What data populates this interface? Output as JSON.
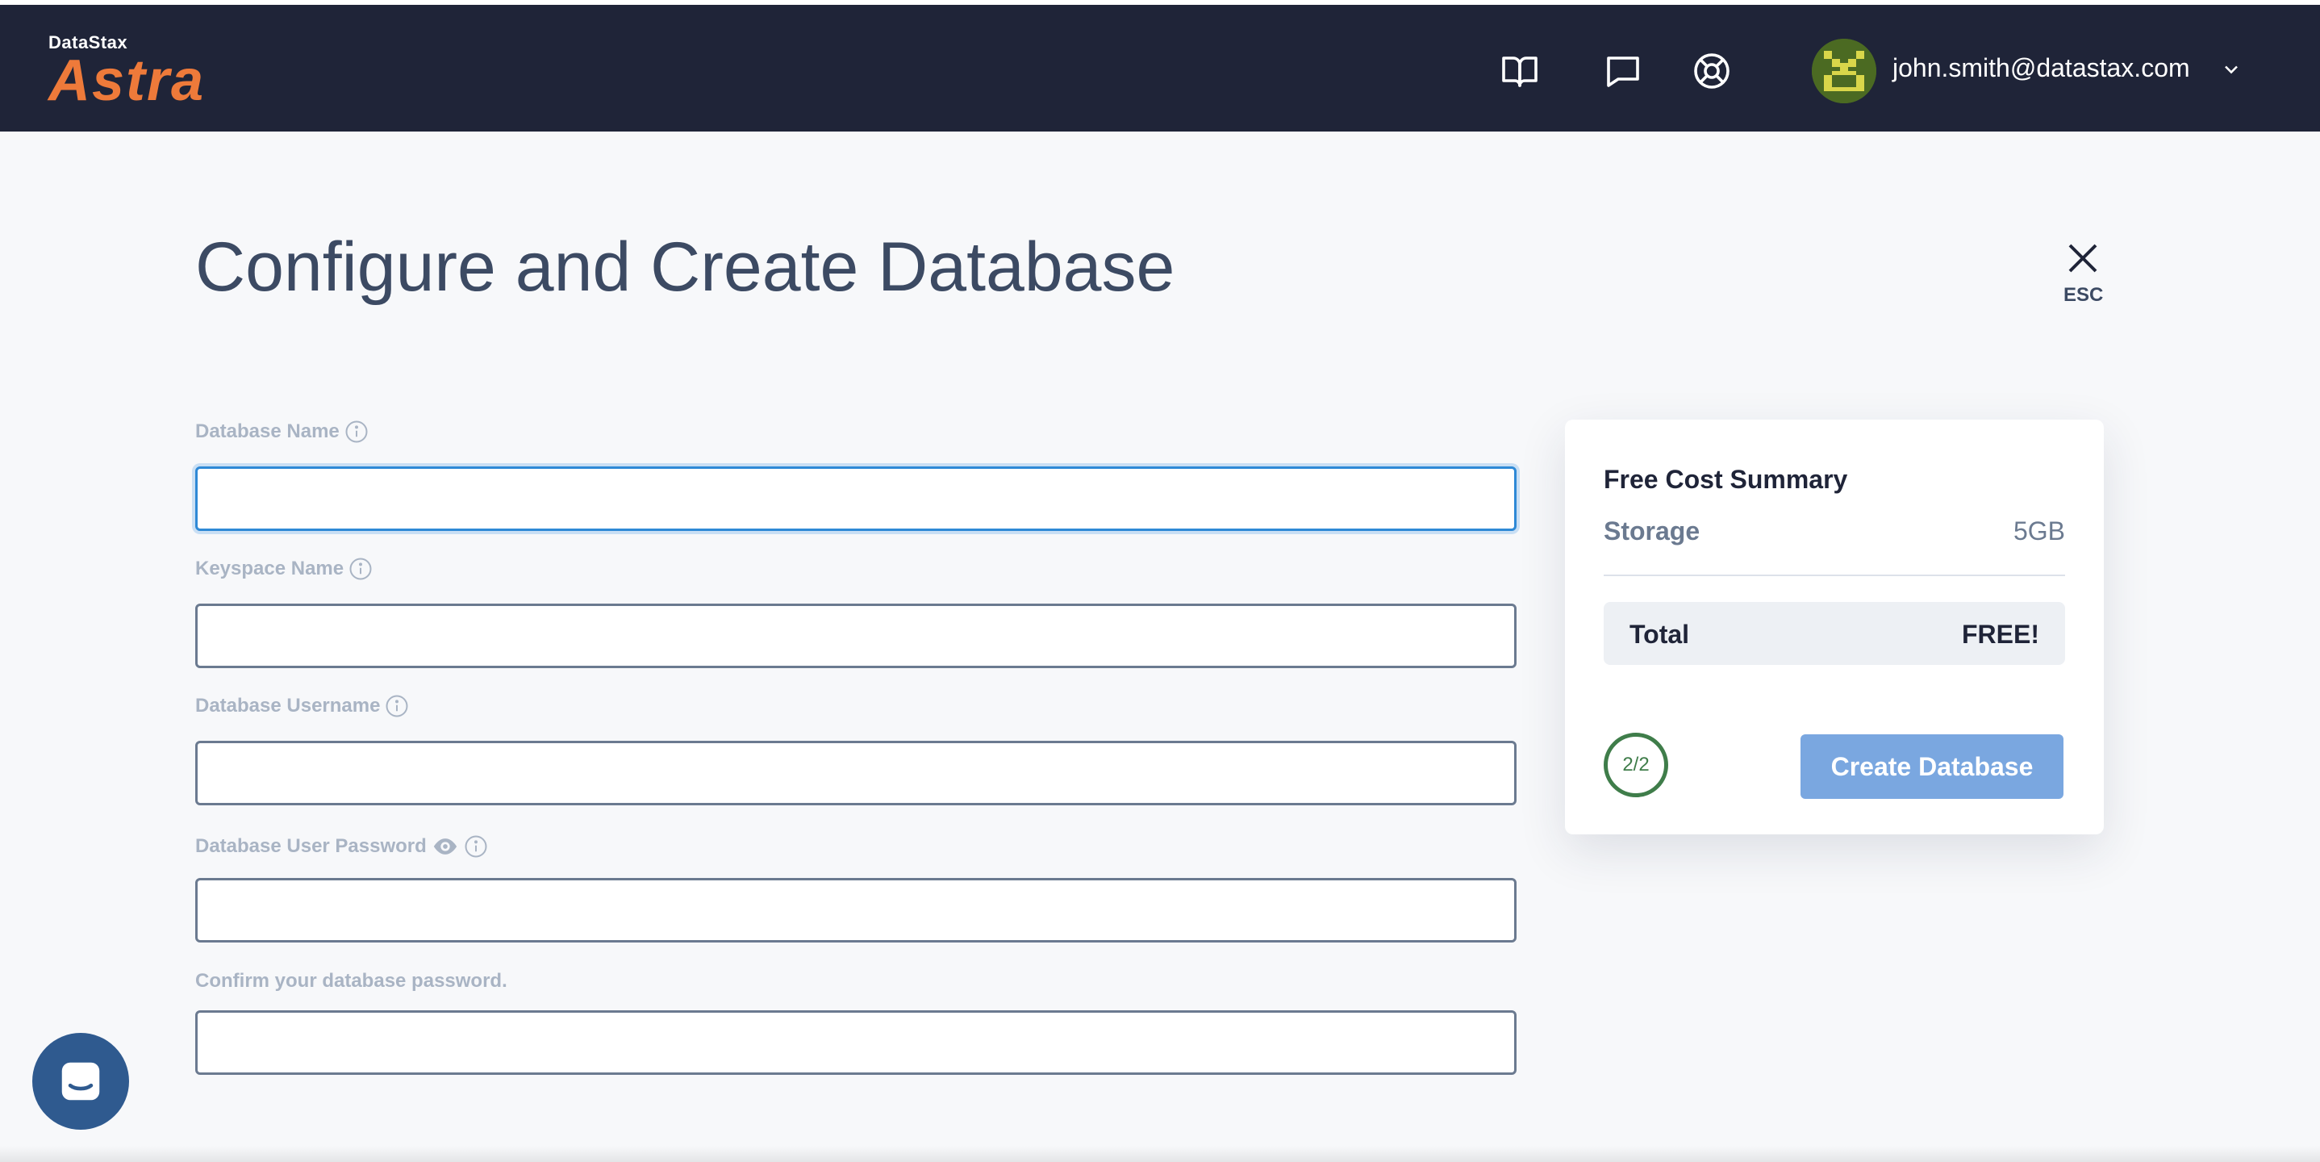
{
  "header": {
    "brand_small": "DataStax",
    "brand_name": "Astra",
    "brand_color": "#ee7a3a",
    "icons": [
      "book-icon",
      "chat-icon",
      "support-icon"
    ],
    "user_email": "john.smith@datastax.com"
  },
  "page": {
    "title": "Configure and Create Database",
    "close_label": "ESC"
  },
  "form": {
    "database_name": {
      "label": "Database Name",
      "value": ""
    },
    "keyspace_name": {
      "label": "Keyspace Name",
      "value": ""
    },
    "database_username": {
      "label": "Database Username",
      "value": ""
    },
    "database_password": {
      "label": "Database User Password",
      "value": ""
    },
    "confirm_password": {
      "label": "Confirm your database password.",
      "value": ""
    }
  },
  "summary": {
    "title": "Free Cost Summary",
    "storage_label": "Storage",
    "storage_value": "5GB",
    "total_label": "Total",
    "total_value": "FREE!",
    "step": "2/2",
    "create_label": "Create Database",
    "create_color": "#7aa7e0"
  },
  "colors": {
    "header_bg": "#1f2438",
    "focus_border": "#2e89d6",
    "step_ring": "#3f7d4a",
    "chat_bubble": "#2f5a8f"
  }
}
